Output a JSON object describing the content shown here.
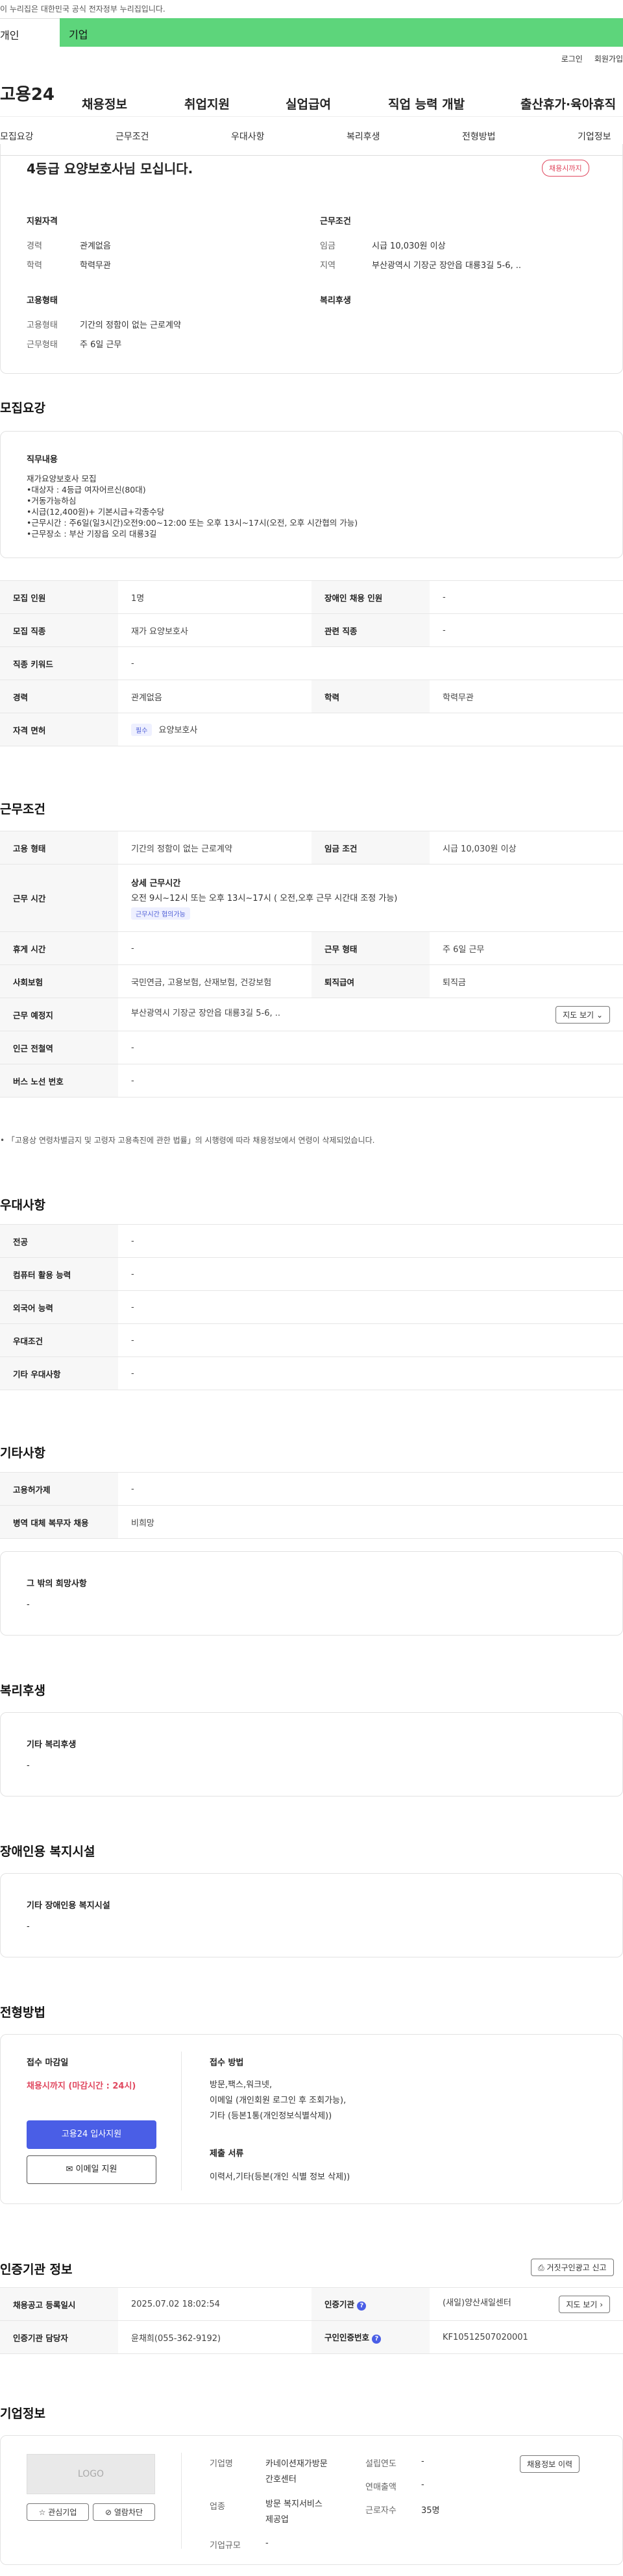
{
  "gov_banner": "이 누리집은 대한민국 공식 전자정부 누리집입니다.",
  "top_tabs": [
    "개인",
    "기업"
  ],
  "util": {
    "login": "로그인",
    "join": "회원가입"
  },
  "gnb": {
    "logo": "고용24",
    "menu": [
      "채용정보",
      "취업지원",
      "실업급여",
      "직업 능력 개발",
      "출산휴가·육아휴직"
    ]
  },
  "lnb": [
    "모집요강",
    "근무조건",
    "우대사항",
    "복리후생",
    "전형방법",
    "기업정보"
  ],
  "summary": {
    "title": "4등급 요양보호사님 모십니다.",
    "badge": "채용시까지",
    "qual_title": "지원자격",
    "qual": [
      {
        "k": "경력",
        "v": "관계없음"
      },
      {
        "k": "학력",
        "v": "학력무관"
      }
    ],
    "work_title": "근무조건",
    "work": [
      {
        "k": "임금",
        "v": "시급 10,030원 이상"
      },
      {
        "k": "지역",
        "v": "부산광역시 기장군 장안읍 대룡3길 5-6, .."
      }
    ],
    "emp_title": "고용형태",
    "emp": [
      {
        "k": "고용형태",
        "v": "기간의 정함이 없는 근로계약"
      },
      {
        "k": "근무형태",
        "v": "주 6일 근무"
      }
    ],
    "welfare_title": "복리후생"
  },
  "recruit": {
    "title": "모집요강",
    "duty_title": "직무내용",
    "duty_lines": [
      "재가요양보호사 모집",
      "•대상자 : 4등급 여자어르신(80대)",
      "•거동가능하심",
      "•시급(12,400원)+ 기본시급+각종수당",
      "•근무시간 : 주6일(일3시간)오전9:00~12:00 또는 오후 13시~17시(오전, 오후 시간협의 가능)",
      "•근무장소 : 부산 기장읍 오리 대룡3길"
    ],
    "rows": [
      {
        "k1": "모집 인원",
        "v1": "1명",
        "k2": "장애인 채용 인원",
        "v2": "-"
      },
      {
        "k1": "모집 직종",
        "v1": "재가 요양보호사",
        "k2": "관련 직종",
        "v2": "-"
      }
    ],
    "keyword": {
      "k": "직종 키워드",
      "v": "-"
    },
    "edu_row": {
      "k1": "경력",
      "v1": "관계없음",
      "k2": "학력",
      "v2": "학력무관"
    },
    "license": {
      "k": "자격 면허",
      "tag": "필수",
      "v": "요양보호사"
    }
  },
  "work_cond": {
    "title": "근무조건",
    "row1": {
      "k1": "고용 형태",
      "v1": "기간의 정함이 없는 근로계약",
      "k2": "임금 조건",
      "v2": "시급 10,030원 이상"
    },
    "hours": {
      "k": "근무 시간",
      "head": "상세 근무시간",
      "detail": "오전 9시~12시 또는 오후 13시~17시 ( 오전,오후 근무 시간대 조정 가능)",
      "tag": "근무시간 협의가능"
    },
    "row3": {
      "k1": "휴게 시간",
      "v1": "-",
      "k2": "근무 형태",
      "v2": "주 6일 근무"
    },
    "row4": {
      "k1": "사회보험",
      "v1": "국민연금, 고용보험, 산재보험, 건강보험",
      "k2": "퇴직급여",
      "v2": "퇴직금"
    },
    "place": {
      "k": "근무 예정지",
      "v": "부산광역시 기장군 장안읍 대룡3길 5-6, ..",
      "btn": "지도 보기"
    },
    "subway": {
      "k": "인근 전철역",
      "v": "-"
    },
    "bus": {
      "k": "버스 노선 번호",
      "v": "-"
    },
    "note": "「고용상 연령차별금지 및 고령자 고용촉진에 관한 법률」의 시행령에 따라 채용정보에서 연령이 삭제되었습니다."
  },
  "pref": {
    "title": "우대사항",
    "rows": [
      {
        "k": "전공",
        "v": "-"
      },
      {
        "k": "컴퓨터 활용 능력",
        "v": "-"
      },
      {
        "k": "외국어 능력",
        "v": "-"
      },
      {
        "k": "우대조건",
        "v": "-"
      },
      {
        "k": "기타 우대사항",
        "v": "-"
      }
    ]
  },
  "etc": {
    "title": "기타사항",
    "rows": [
      {
        "k": "고용허가제",
        "v": "-"
      },
      {
        "k": "병역 대체 복무자 채용",
        "v": "비희망"
      }
    ],
    "box_title": "그 밖의 희망사항",
    "box_val": "-"
  },
  "welfare": {
    "title": "복리후생",
    "box_title": "기타 복리후생",
    "box_val": "-"
  },
  "disabled": {
    "title": "장애인용 복지시설",
    "box_title": "기타 장애인용 복지시설",
    "box_val": "-"
  },
  "process": {
    "title": "전형방법",
    "deadline_title": "접수 마감일",
    "deadline_val": "채용시까지 (마감시간 : 24시)",
    "apply_btn": "고용24 입사지원",
    "email_btn": "이메일 지원",
    "method_title": "접수 방법",
    "method_lines": [
      "방문,팩스,워크넷,",
      "이메일 (개인회원 로그인 후 조회가능),",
      "기타 (등본1통(개인정보식별삭제))"
    ],
    "docs_title": "제출 서류",
    "docs_val": "이력서,기타(등본(개인 식별 정보 삭제))"
  },
  "cert": {
    "title": "인증기관 정보",
    "report_btn": "거짓구인광고 신고",
    "rows": [
      {
        "k1": "채용공고 등록일시",
        "v1": "2025.07.02 18:02:54",
        "k2": "인증기관",
        "v2": "(새일)양산새일센터",
        "btn": "지도 보기"
      },
      {
        "k1": "인증기관 담당자",
        "v1": "윤채희(055-362-9192)",
        "k2": "구인인증번호",
        "v2": "KF10512507020001"
      }
    ]
  },
  "company": {
    "title": "기업정보",
    "logo": "LOGO",
    "fav_btn": "관심기업",
    "block_btn": "열람차단",
    "name_k": "기업명",
    "name_v": [
      "카네이션재가방문",
      "간호센터"
    ],
    "ind_k": "업종",
    "ind_v": [
      "방문 복지서비스",
      "제공업"
    ],
    "size_k": "기업규모",
    "size_v": "-",
    "year_k": "설립연도",
    "year_v": "-",
    "sales_k": "연매출액",
    "sales_v": "-",
    "emp_k": "근로자수",
    "emp_v": "35명",
    "history_btn": "채용정보 이력"
  }
}
